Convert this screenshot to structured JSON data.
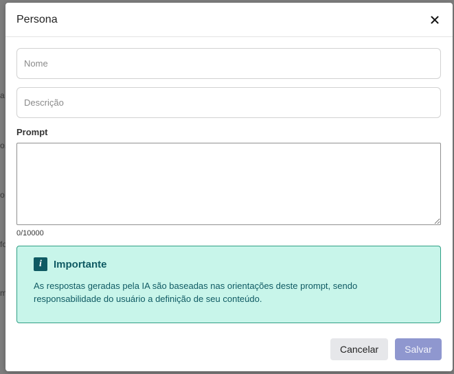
{
  "background": {
    "fragments": [
      "a",
      "o.",
      "o",
      "fo",
      "m"
    ]
  },
  "modal": {
    "title": "Persona",
    "close_icon": "close-icon"
  },
  "form": {
    "name_placeholder": "Nome",
    "description_placeholder": "Descrição",
    "prompt_label": "Prompt",
    "prompt_value": "",
    "counter": "0/10000"
  },
  "alert": {
    "icon": "info-icon",
    "icon_glyph": "i",
    "title": "Importante",
    "text": "As respostas geradas pela IA são baseadas nas orientações deste prompt, sendo responsabilidade do usuário a definição de seu conteúdo.",
    "background_color": "#c8f5ea",
    "accent_color": "#0f5a63"
  },
  "footer": {
    "cancel_label": "Cancelar",
    "save_label": "Salvar"
  },
  "colors": {
    "save_button": "#8f97cf",
    "cancel_button": "#e6e7ea"
  }
}
